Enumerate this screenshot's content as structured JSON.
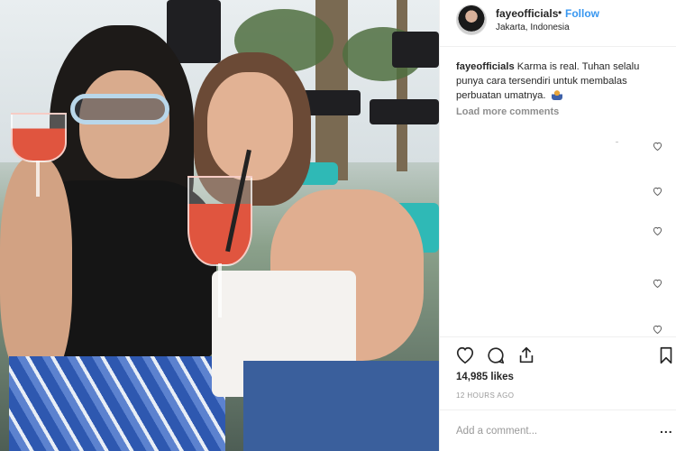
{
  "post": {
    "username": "fayeofficials",
    "separator": "•",
    "follow_label": "Follow",
    "location": "Jakarta, Indonesia"
  },
  "caption": {
    "username": "fayeofficials",
    "text": "Karma is real. Tuhan selalu punya cara tersendiri untuk membalas perbuatan umatnya.",
    "emoji_icon": "praying-emoji"
  },
  "comments": {
    "load_more_label": "Load more comments"
  },
  "actions": {
    "icons": [
      "heart-icon",
      "comment-icon",
      "share-icon",
      "bookmark-icon"
    ],
    "likes_label": "14,985 likes",
    "time_label": "12 HOURS AGO"
  },
  "comment_box": {
    "placeholder": "Add a comment...",
    "more_label": "..."
  },
  "colors": {
    "accent": "#3897f0",
    "text": "#262626",
    "muted": "#8e8e8e",
    "border": "#efefef"
  }
}
